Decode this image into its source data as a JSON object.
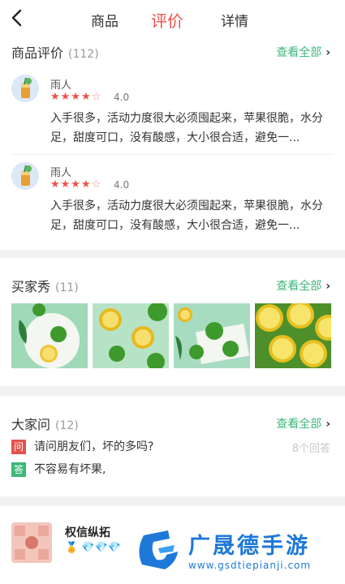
{
  "nav": {
    "tabs": [
      {
        "label": "商品"
      },
      {
        "label": "评价"
      },
      {
        "label": "详情"
      }
    ]
  },
  "reviews": {
    "title": "商品评价",
    "count": "(112)",
    "see_all": "查看全部",
    "items": [
      {
        "user": "雨人",
        "stars": 4,
        "score": "4.0",
        "text": "入手很多，活动力度很大必须囤起来，苹果很脆，水分足，甜度可口，没有酸感，大小很合适，避免一..."
      },
      {
        "user": "雨人",
        "stars": 4,
        "score": "4.0",
        "text": "入手很多，活动力度很大必须囤起来，苹果很脆，水分足，甜度可口，没有酸感，大小很合适，避免一..."
      }
    ]
  },
  "buyer_show": {
    "title": "买家秀",
    "count": "(11)",
    "see_all": "查看全部"
  },
  "qa": {
    "title": "大家问",
    "count": "(12)",
    "see_all": "查看全部",
    "question_badge": "问",
    "answer_badge": "答",
    "question": "请问朋友们，坏的多吗?",
    "answers_count": "8个回答",
    "answer": "不容易有坏果,",
    "question_color": "#e2534c",
    "answer_color": "#3cb878"
  },
  "shop": {
    "name": "权信纵拓"
  },
  "watermark": {
    "name": "广晟德手游",
    "url": "www.gsdtiepianji.com"
  },
  "colors": {
    "accent_red": "#f0504a",
    "accent_green": "#3cb878"
  }
}
